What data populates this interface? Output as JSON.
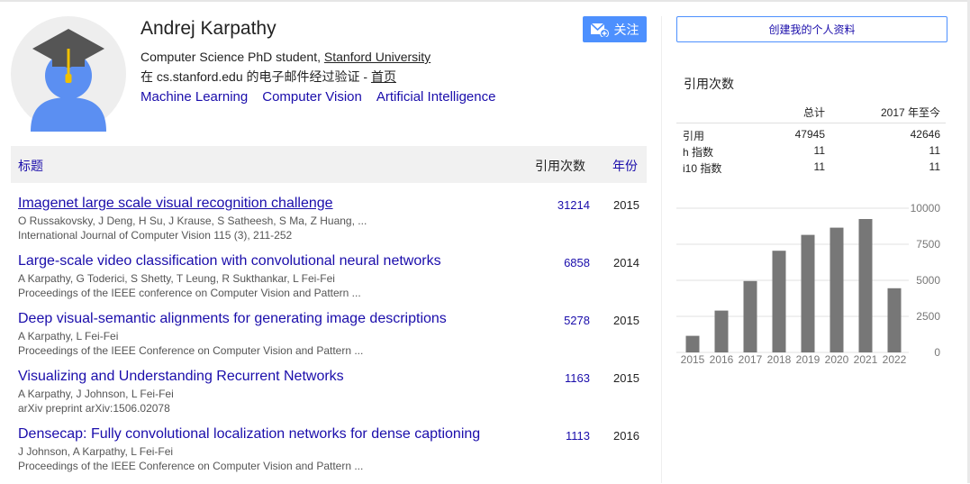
{
  "profile": {
    "name": "Andrej Karpathy",
    "affiliation_prefix": "Computer Science PhD student, ",
    "affiliation_link": "Stanford University",
    "verified_prefix": "在 cs.stanford.edu 的电子邮件经过验证 - ",
    "homepage_link": "首页",
    "interests": [
      "Machine Learning",
      "Computer Vision",
      "Artificial Intelligence"
    ],
    "avatar_icon": "graduate-avatar-icon"
  },
  "follow": {
    "label": "关注",
    "icon": "mail-plus-icon",
    "color": "#4d90fe"
  },
  "table": {
    "headers": {
      "title": "标题",
      "cites": "引用次数",
      "year": "年份"
    },
    "rows": [
      {
        "title": "Imagenet large scale visual recognition challenge",
        "authors": "O Russakovsky, J Deng, H Su, J Krause, S Satheesh, S Ma, Z Huang, ...",
        "venue": "International Journal of Computer Vision 115 (3), 211-252",
        "cites": "31214",
        "year": "2015"
      },
      {
        "title": "Large-scale video classification with convolutional neural networks",
        "authors": "A Karpathy, G Toderici, S Shetty, T Leung, R Sukthankar, L Fei-Fei",
        "venue": "Proceedings of the IEEE conference on Computer Vision and Pattern ...",
        "cites": "6858",
        "year": "2014"
      },
      {
        "title": "Deep visual-semantic alignments for generating image descriptions",
        "authors": "A Karpathy, L Fei-Fei",
        "venue": "Proceedings of the IEEE Conference on Computer Vision and Pattern ...",
        "cites": "5278",
        "year": "2015"
      },
      {
        "title": "Visualizing and Understanding Recurrent Networks",
        "authors": "A Karpathy, J Johnson, L Fei-Fei",
        "venue": "arXiv preprint arXiv:1506.02078",
        "cites": "1163",
        "year": "2015"
      },
      {
        "title": "Densecap: Fully convolutional localization networks for dense captioning",
        "authors": "J Johnson, A Karpathy, L Fei-Fei",
        "venue": "Proceedings of the IEEE Conference on Computer Vision and Pattern ...",
        "cites": "1113",
        "year": "2016"
      }
    ]
  },
  "sidebar": {
    "create_button": "创建我的个人资料",
    "stats_title": "引用次数",
    "col_all": "总计",
    "col_since": "2017 年至今",
    "stats": [
      {
        "label": "引用",
        "all": "47945",
        "since": "42646"
      },
      {
        "label": "h 指数",
        "all": "11",
        "since": "11"
      },
      {
        "label": "i10 指数",
        "all": "11",
        "since": "11"
      }
    ]
  },
  "chart_data": {
    "type": "bar",
    "categories": [
      "2015",
      "2016",
      "2017",
      "2018",
      "2019",
      "2020",
      "2021",
      "2022"
    ],
    "values": [
      1150,
      2900,
      4950,
      7050,
      8150,
      8650,
      9250,
      4450
    ],
    "ylim": [
      0,
      10000
    ],
    "yticks": [
      "10000",
      "7500",
      "5000",
      "2500",
      "0"
    ],
    "ytick_values": [
      10000,
      7500,
      5000,
      2500,
      0
    ],
    "bar_color": "#777777",
    "grid": true
  }
}
